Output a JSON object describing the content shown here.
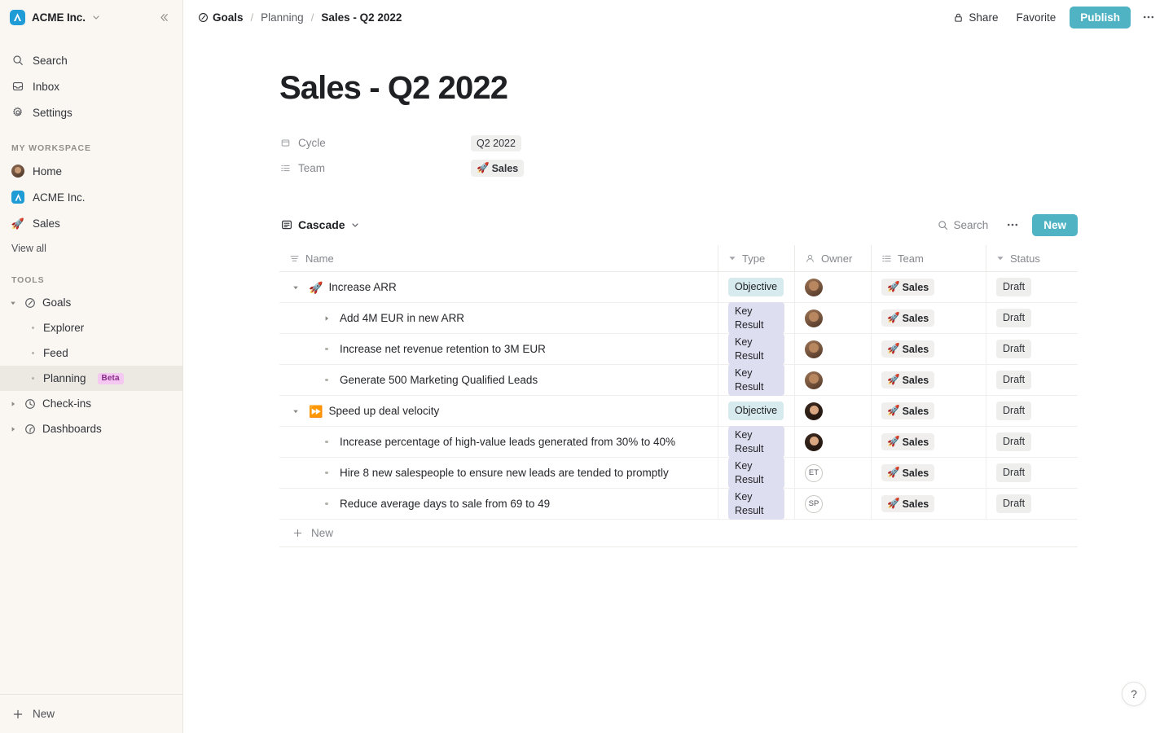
{
  "sidebar": {
    "workspace": {
      "name": "ACME Inc.",
      "logo_icon": "acme-logo-icon",
      "chevron_icon": "chevron-down-icon"
    },
    "collapse_icon": "collapse-sidebar-icon",
    "nav": [
      {
        "label": "Search",
        "icon": "search-icon"
      },
      {
        "label": "Inbox",
        "icon": "inbox-icon"
      },
      {
        "label": "Settings",
        "icon": "gear-icon"
      }
    ],
    "workspace_section": {
      "title": "MY WORKSPACE",
      "items": [
        {
          "label": "Home",
          "icon": "avatar-icon"
        },
        {
          "label": "ACME Inc.",
          "icon": "acme-logo-icon"
        },
        {
          "label": "Sales",
          "icon": "rocket-emoji",
          "emoji": "🚀"
        }
      ],
      "view_all": "View all"
    },
    "tools_section": {
      "title": "TOOLS",
      "items": [
        {
          "label": "Goals",
          "icon": "goals-icon",
          "expanded": true
        },
        {
          "label": "Explorer",
          "icon": "bullet-icon",
          "sub": true
        },
        {
          "label": "Feed",
          "icon": "bullet-icon",
          "sub": true
        },
        {
          "label": "Planning",
          "icon": "bullet-icon",
          "sub": true,
          "badge": "Beta",
          "selected": true
        },
        {
          "label": "Check-ins",
          "icon": "clock-icon",
          "expanded": false
        },
        {
          "label": "Dashboards",
          "icon": "dashboard-icon",
          "expanded": false
        }
      ]
    },
    "new_button": {
      "label": "New",
      "icon": "plus-icon"
    }
  },
  "topbar": {
    "breadcrumb": [
      {
        "label": "Goals",
        "icon": "goals-icon"
      },
      {
        "label": "Planning"
      },
      {
        "label": "Sales - Q2 2022"
      }
    ],
    "separator": "/",
    "share_label": "Share",
    "share_icon": "lock-icon",
    "favorite_label": "Favorite",
    "publish_label": "Publish",
    "more_icon": "ellipsis-icon"
  },
  "page": {
    "title": "Sales - Q2 2022",
    "properties": [
      {
        "label": "Cycle",
        "icon": "cycle-icon",
        "value": "Q2 2022",
        "bold": false
      },
      {
        "label": "Team",
        "icon": "list-icon",
        "value": "Sales",
        "emoji": "🚀",
        "bold": true
      }
    ]
  },
  "view": {
    "selector_label": "Cascade",
    "selector_icon": "cascade-view-icon",
    "chevron_icon": "chevron-down-icon",
    "search_label": "Search",
    "search_icon": "search-icon",
    "more_icon": "ellipsis-icon",
    "new_label": "New"
  },
  "table": {
    "columns": [
      {
        "key": "name",
        "label": "Name",
        "icon": "name-list-icon"
      },
      {
        "key": "type",
        "label": "Type",
        "icon": "filter-triangle-icon"
      },
      {
        "key": "owner",
        "label": "Owner",
        "icon": "person-icon"
      },
      {
        "key": "team",
        "label": "Team",
        "icon": "list-icon"
      },
      {
        "key": "status",
        "label": "Status",
        "icon": "filter-triangle-icon"
      }
    ],
    "rows": [
      {
        "name": "Increase ARR",
        "emoji": "🚀",
        "level": 0,
        "toggle": "expanded",
        "type": "Objective",
        "owner_kind": "photo-a",
        "owner_initials": "",
        "team": "Sales",
        "team_emoji": "🚀",
        "status": "Draft"
      },
      {
        "name": "Add 4M EUR in new ARR",
        "emoji": "",
        "level": 1,
        "toggle": "collapsed",
        "type": "Key Result",
        "owner_kind": "photo-a",
        "owner_initials": "",
        "team": "Sales",
        "team_emoji": "🚀",
        "status": "Draft"
      },
      {
        "name": "Increase net revenue retention to 3M EUR",
        "emoji": "",
        "level": 1,
        "toggle": "bullet",
        "type": "Key Result",
        "owner_kind": "photo-a",
        "owner_initials": "",
        "team": "Sales",
        "team_emoji": "🚀",
        "status": "Draft"
      },
      {
        "name": "Generate 500 Marketing Qualified Leads",
        "emoji": "",
        "level": 1,
        "toggle": "bullet",
        "type": "Key Result",
        "owner_kind": "photo-a",
        "owner_initials": "",
        "team": "Sales",
        "team_emoji": "🚀",
        "status": "Draft"
      },
      {
        "name": "Speed up deal velocity",
        "emoji": "⏩",
        "level": 0,
        "toggle": "expanded",
        "type": "Objective",
        "owner_kind": "photo-b",
        "owner_initials": "",
        "team": "Sales",
        "team_emoji": "🚀",
        "status": "Draft"
      },
      {
        "name": "Increase percentage of high-value leads generated from 30% to 40%",
        "emoji": "",
        "level": 1,
        "toggle": "bullet",
        "type": "Key Result",
        "owner_kind": "photo-b",
        "owner_initials": "",
        "team": "Sales",
        "team_emoji": "🚀",
        "status": "Draft"
      },
      {
        "name": "Hire 8 new salespeople to ensure new leads are tended to promptly",
        "emoji": "",
        "level": 1,
        "toggle": "bullet",
        "type": "Key Result",
        "owner_kind": "initials",
        "owner_initials": "ET",
        "team": "Sales",
        "team_emoji": "🚀",
        "status": "Draft"
      },
      {
        "name": "Reduce average days to sale from 69 to 49",
        "emoji": "",
        "level": 1,
        "toggle": "bullet",
        "type": "Key Result",
        "owner_kind": "initials",
        "owner_initials": "SP",
        "team": "Sales",
        "team_emoji": "🚀",
        "status": "Draft"
      }
    ],
    "new_row_label": "New",
    "new_row_icon": "plus-icon"
  },
  "help": {
    "label": "?",
    "icon": "help-icon"
  },
  "colors": {
    "accent": "#4fb3c4",
    "sidebar_bg": "#faf7f3",
    "objective_badge": "#d7eaed",
    "keyresult_badge": "#dedef1",
    "status_badge": "#eeeeec",
    "beta_badge": "#f4c8f0"
  }
}
